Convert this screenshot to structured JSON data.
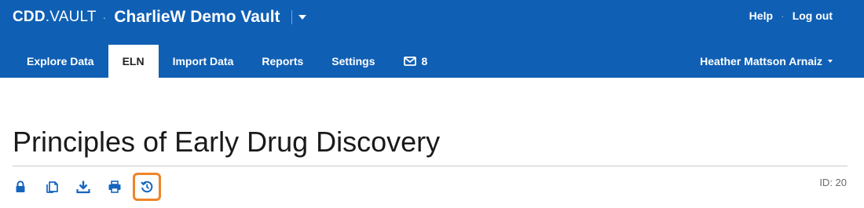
{
  "brand": {
    "logo_bold": "CDD",
    "logo_thin": "VAULT",
    "separator": "·",
    "vault_name": "CharlieW Demo Vault"
  },
  "top_links": {
    "help": "Help",
    "separator": "·",
    "logout": "Log out"
  },
  "tabs": [
    {
      "label": "Explore Data",
      "active": false
    },
    {
      "label": "ELN",
      "active": true
    },
    {
      "label": "Import Data",
      "active": false
    },
    {
      "label": "Reports",
      "active": false
    },
    {
      "label": "Settings",
      "active": false
    }
  ],
  "messages": {
    "count": "8",
    "icon": "envelope-icon"
  },
  "user": {
    "name": "Heather Mattson Arnaiz"
  },
  "page": {
    "title": "Principles of Early Drug Discovery",
    "id_label": "ID: 20"
  },
  "toolbar": {
    "icons": [
      "lock-icon",
      "copy-icon",
      "download-icon",
      "print-icon",
      "history-icon"
    ],
    "highlighted": "history-icon"
  },
  "colors": {
    "header_bg": "#0f5fb4",
    "icon_blue": "#1565c0",
    "highlight_orange": "#ef8427"
  }
}
